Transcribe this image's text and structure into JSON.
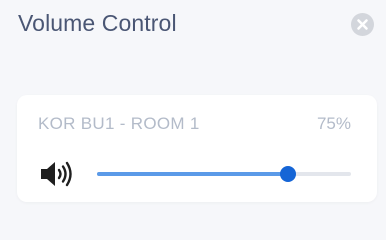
{
  "window": {
    "title": "Volume Control",
    "close_icon": "close-icon"
  },
  "room": {
    "name": "KOR BU1 - ROOM 1",
    "volume_label": "75%",
    "volume_fraction": 0.75,
    "speaker_icon": "speaker-volume-icon"
  },
  "colors": {
    "title_text": "#4a5674",
    "muted_text": "#b3bbc9",
    "slider_fill": "#5b9ae8",
    "slider_thumb": "#1565d6",
    "slider_track": "#e3e6ec"
  }
}
